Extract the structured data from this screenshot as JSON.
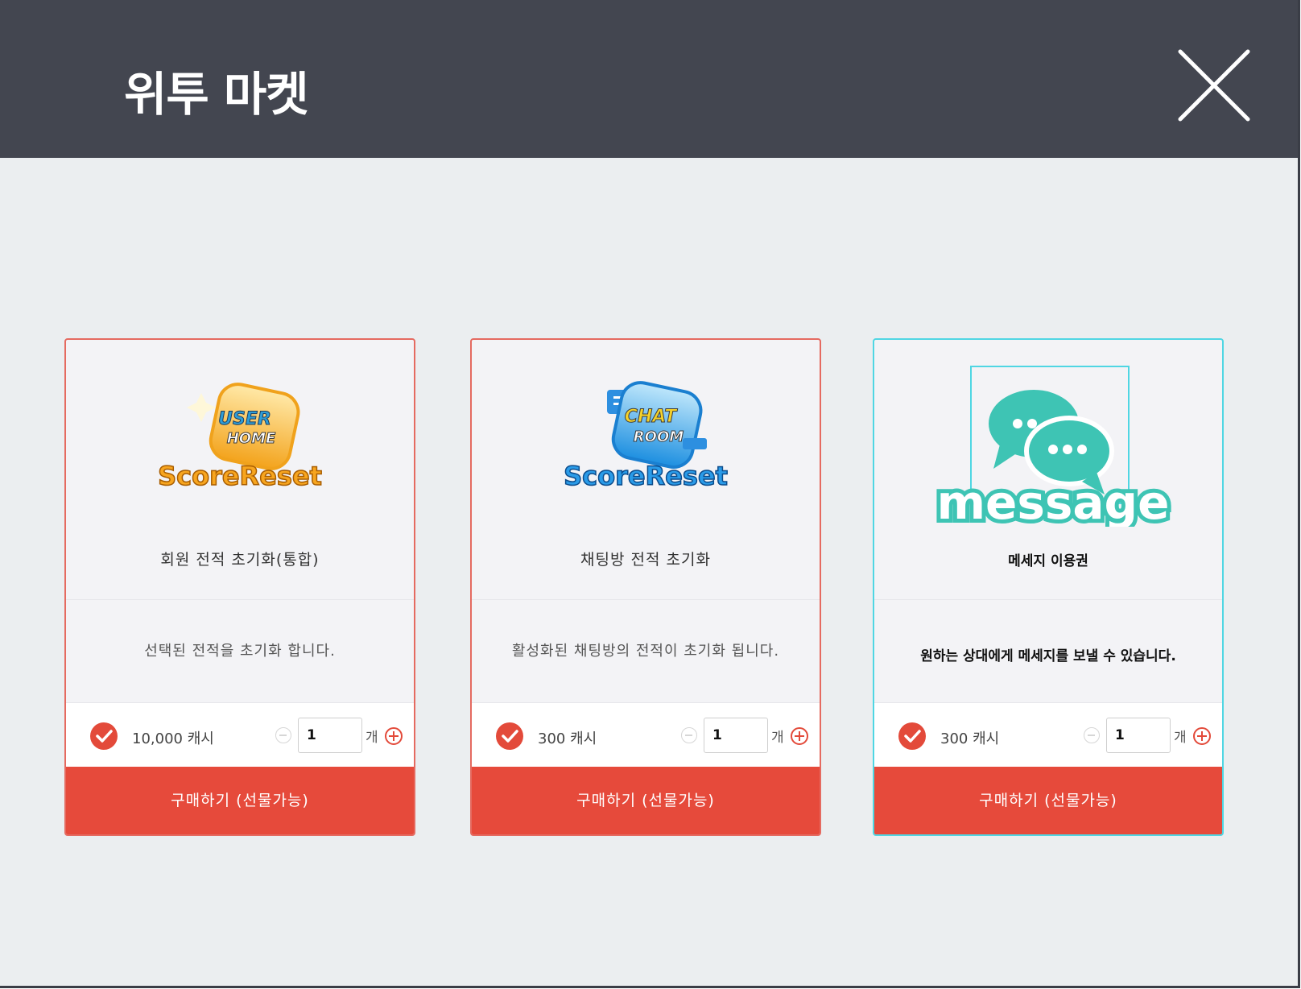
{
  "window": {
    "title": "위투 마켓"
  },
  "colors": {
    "titlebar": "#434650",
    "background": "#ebeef0",
    "accent_red": "#e64a3b",
    "selected_border": "#4fd6e3",
    "message_teal": "#3ec4b4"
  },
  "cards": [
    {
      "icon": "user-home-scorereset-icon",
      "icon_text_top": "USER",
      "icon_text_mid": "HOME",
      "icon_text_bottom": "ScoreReset",
      "name": "회원 전적 초기화(통합)",
      "description": "선택된 전적을 초기화 합니다.",
      "price": "10,000 캐시",
      "quantity": "1",
      "unit": "개",
      "buy_label": "구매하기 (선물가능)",
      "selected": false
    },
    {
      "icon": "chat-room-scorereset-icon",
      "icon_text_top": "CHAT",
      "icon_text_mid": "ROOM",
      "icon_text_bottom": "ScoreReset",
      "name": "채팅방 전적 초기화",
      "description": "활성화된 채팅방의 전적이 초기화 됩니다.",
      "price": "300 캐시",
      "quantity": "1",
      "unit": "개",
      "buy_label": "구매하기 (선물가능)",
      "selected": false
    },
    {
      "icon": "message-icon",
      "icon_text_bottom": "message",
      "name": "메세지 이용권",
      "description": "원하는 상대에게 메세지를 보낼 수 있습니다.",
      "price": "300 캐시",
      "quantity": "1",
      "unit": "개",
      "buy_label": "구매하기 (선물가능)",
      "selected": true
    }
  ]
}
